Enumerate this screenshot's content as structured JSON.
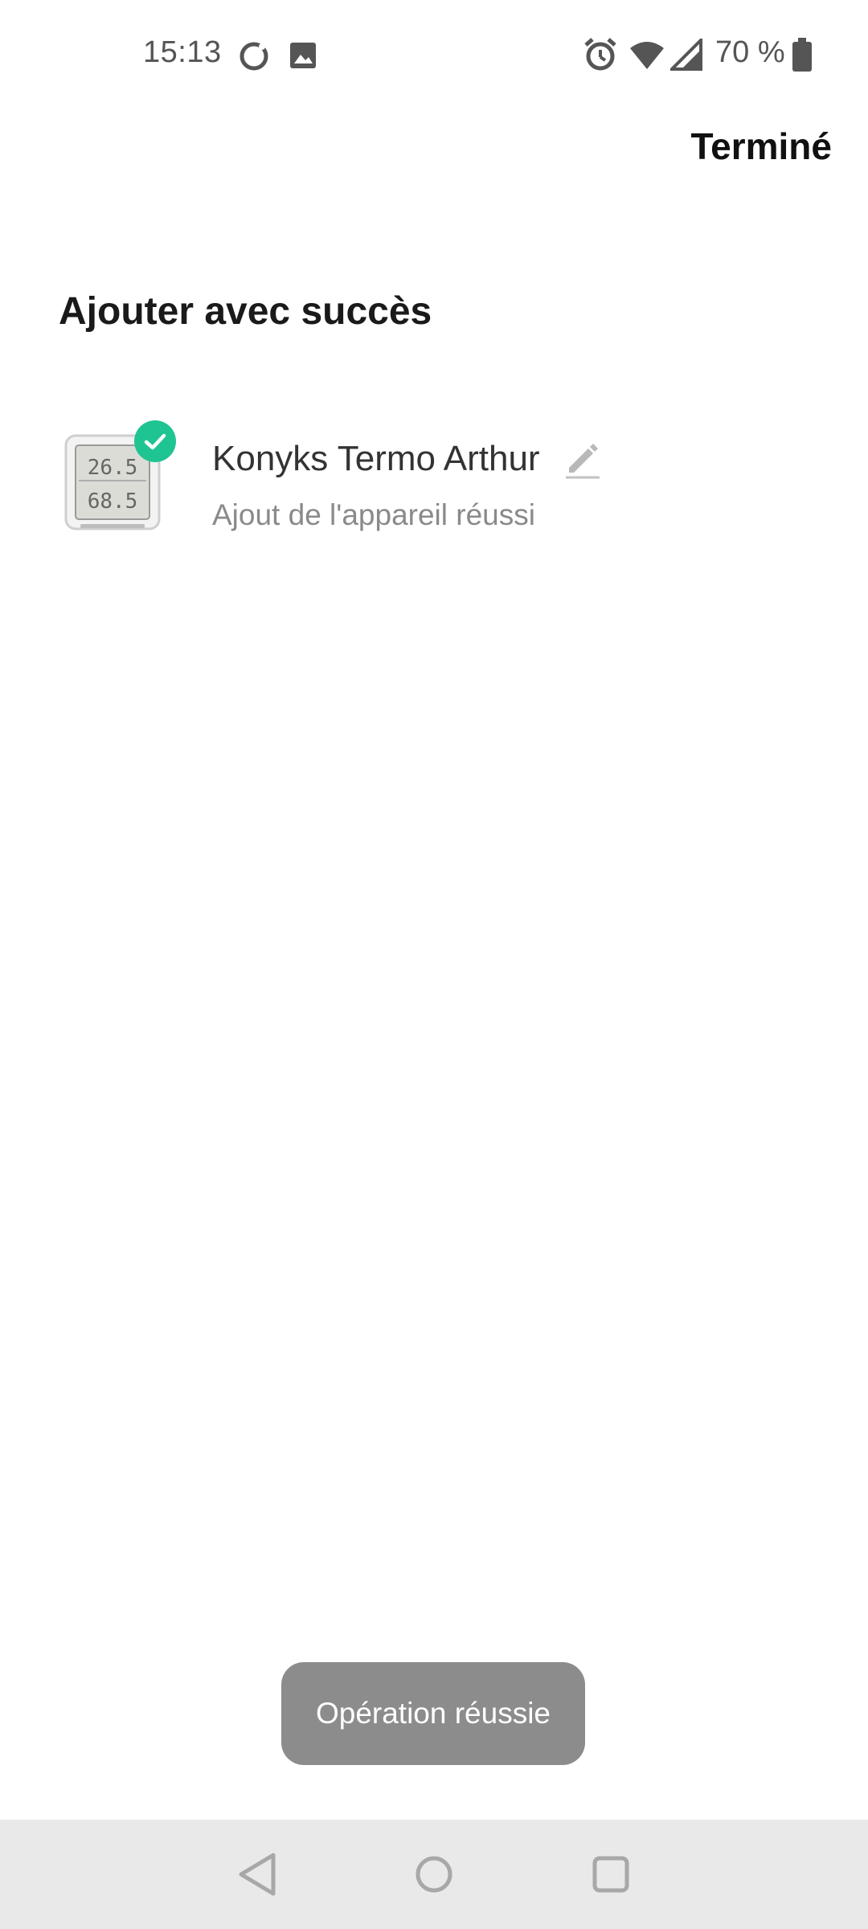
{
  "status_bar": {
    "time": "15:13",
    "battery_text": "70 %",
    "icons": [
      "assistant-circle-icon",
      "image-notification-icon",
      "alarm-icon",
      "wifi-icon",
      "cell-signal-icon",
      "battery-icon"
    ]
  },
  "header": {
    "done_label": "Terminé"
  },
  "main": {
    "title": "Ajouter avec succès",
    "device": {
      "name": "Konyks Termo Arthur",
      "status": "Ajout de l'appareil réussi",
      "screen_temp": "26.5",
      "screen_humidity": "68.5"
    }
  },
  "toast": {
    "message": "Opération réussie"
  },
  "nav_bar": {
    "buttons": [
      "back-icon",
      "home-icon",
      "recents-icon"
    ]
  },
  "colors": {
    "success_badge": "#1fc493",
    "toast_bg": "#8c8c8c",
    "nav_bg": "#e9e9e9"
  }
}
